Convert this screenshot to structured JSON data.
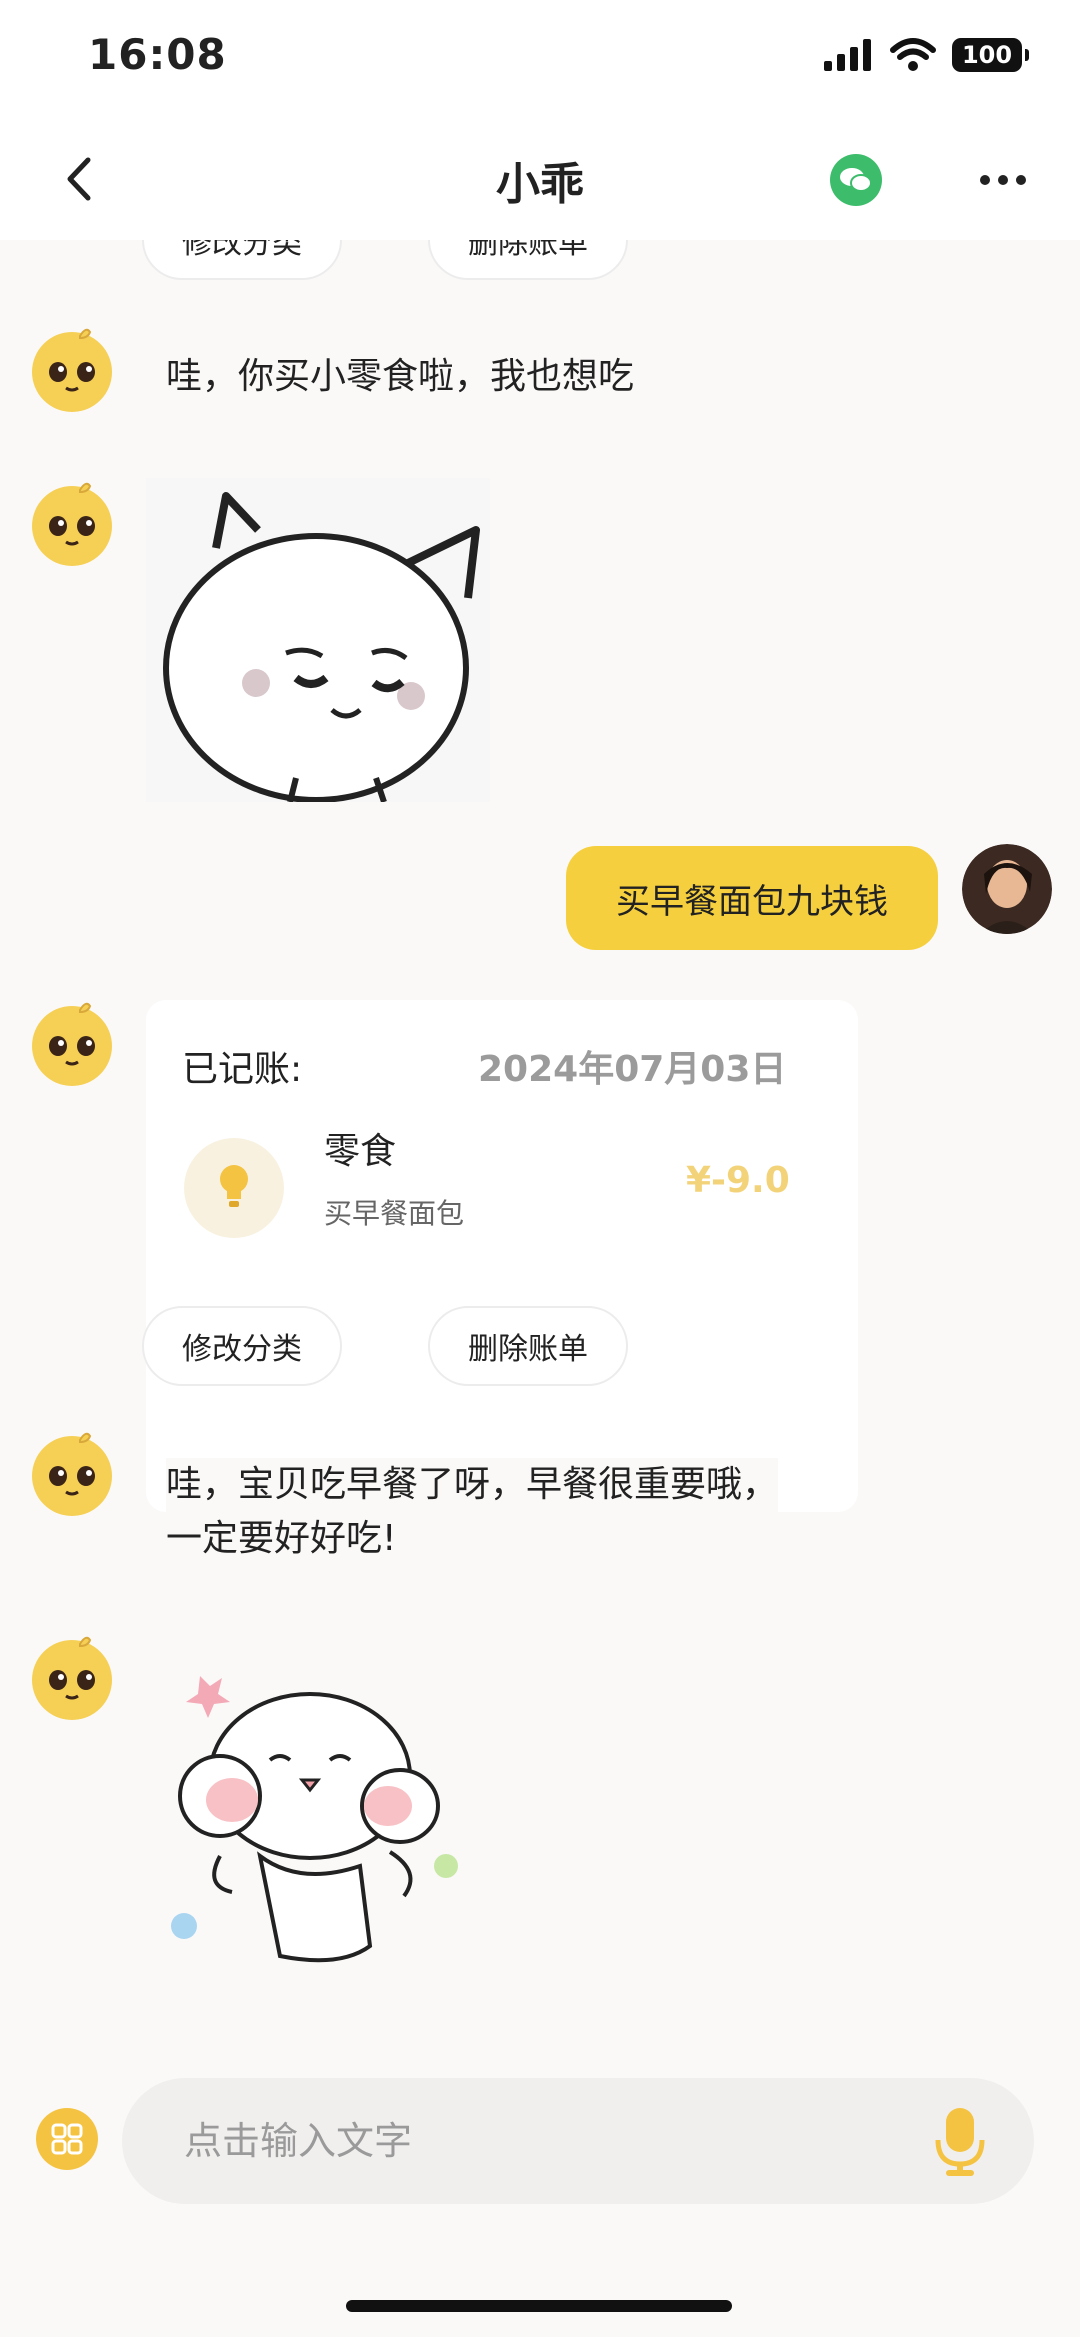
{
  "status_bar": {
    "time": "16:08",
    "battery": "100"
  },
  "header": {
    "title": "小乖"
  },
  "messages": {
    "top_actions": {
      "edit_category": "修改分类",
      "delete_bill": "删除账单"
    },
    "bot_msg_1": "哇，你买小零食啦，我也想吃",
    "user_msg_1": "买早餐面包九块钱",
    "record_card": {
      "label": "已记账:",
      "date": "2024年07月03日",
      "category": "零食",
      "note": "买早餐面包",
      "amount": "¥-9.0"
    },
    "actions": {
      "edit_category": "修改分类",
      "delete_bill": "删除账单"
    },
    "bot_msg_2_line1": "哇，宝贝吃早餐了呀，早餐很重要哦，",
    "bot_msg_2_line2": "一定要好好吃!"
  },
  "input": {
    "placeholder": "点击输入文字"
  },
  "colors": {
    "accent": "#f5cf3e",
    "wechat_green": "#3dbd6b",
    "amount_text": "#f3d37a"
  },
  "icons": [
    "back-icon",
    "wechat-icon",
    "more-icon",
    "signal-icon",
    "wifi-icon",
    "apps-icon",
    "mic-icon",
    "lightbulb-icon"
  ]
}
